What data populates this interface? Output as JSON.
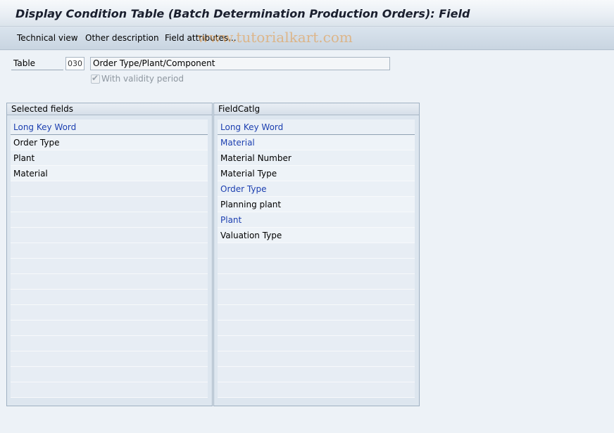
{
  "window": {
    "title": "Display Condition Table (Batch Determination Production Orders): Field"
  },
  "toolbar": {
    "technical_view": "Technical view",
    "other_description": "Other description",
    "field_attributes": "Field attributes..."
  },
  "watermark": "www.tutorialkart.com",
  "form": {
    "table_label": "Table",
    "table_number": "030",
    "table_description": "Order Type/Plant/Component",
    "validity_label": "With validity period",
    "validity_checked": true
  },
  "selected_fields": {
    "title": "Selected fields",
    "column_header": "Long Key Word",
    "rows": [
      "Order Type",
      "Plant",
      "Material"
    ]
  },
  "field_catalog": {
    "title": "FieldCatlg",
    "column_header": "Long Key Word",
    "rows": [
      {
        "label": "Material",
        "highlight": true
      },
      {
        "label": "Material Number",
        "highlight": false
      },
      {
        "label": "Material Type",
        "highlight": false
      },
      {
        "label": "Order Type",
        "highlight": true
      },
      {
        "label": "Planning plant",
        "highlight": false
      },
      {
        "label": "Plant",
        "highlight": true
      },
      {
        "label": "Valuation Type",
        "highlight": false
      }
    ]
  },
  "colors": {
    "link_blue": "#1c3fb0",
    "background": "#edf2f7"
  }
}
